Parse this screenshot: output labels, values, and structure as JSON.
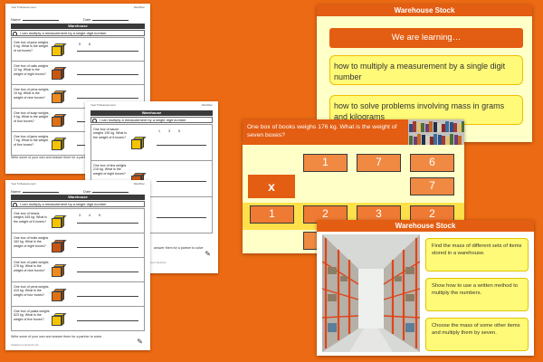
{
  "worksheets": [
    {
      "title": "Warehouse",
      "meta_left": "Year 5 Measurement",
      "meta_right": "Wed/Rec",
      "name_label": "Name",
      "date_label": "Date",
      "instruction": "I can multiply a measurement by a single digit number",
      "rows": [
        {
          "question": "One box of juice weighs 5 kg. What is the weight of six boxes?",
          "box_color": "#f5c400",
          "calc": "5  6"
        },
        {
          "question": "One box of nails weighs 12 kg. What is the weight of eight boxes?",
          "box_color": "#c95510",
          "calc": ""
        },
        {
          "question": "One box of pens weighs 15 kg. What is the weight of nine boxes?",
          "box_color": "#f08a1c",
          "calc": ""
        },
        {
          "question": "One box of soap weighs 9 kg. What is the weight of four boxes?",
          "box_color": "#e07012",
          "calc": ""
        },
        {
          "question": "One box of jams weighs 7 kg. What is the weight of five boxes?",
          "box_color": "#f5c400",
          "calc": ""
        }
      ],
      "footer": "Write some of your own and answer them for a partner to solve."
    },
    {
      "title": "Warehouse",
      "meta_left": "Year 5 Measurement",
      "meta_right": "Wed/Rec",
      "name_label": "Name",
      "date_label": "Date",
      "instruction": "I can multiply a measurement by a single digit number",
      "rows": [
        {
          "question": "One box of sauce weighs 135 kg. What is the weight of 6 boxes?",
          "box_color": "#f5c400",
          "calc": "1 3 5"
        },
        {
          "question": "One box of tins weighs 215 kg. What is the weight of eight boxes?",
          "box_color": "#c95510",
          "calc": ""
        },
        {
          "question": "One box of toys weighs 327 kg. What is the weight of nine boxes?",
          "box_color": "#f08a1c",
          "calc": ""
        }
      ],
      "footer": "answer them for a partner to solve",
      "logo": "Classroom Secrets"
    },
    {
      "title": "Warehouse",
      "meta_left": "Year 5 Measurement",
      "meta_right": "Wed/Rec",
      "name_label": "Name",
      "date_label": "Date",
      "instruction": "I can multiply a measurement by a single digit number",
      "rows": [
        {
          "question": "One box of beans weighs 345 kg. What is the weight of 6 boxes?",
          "box_color": "#f5c400",
          "calc": "3 4 5"
        },
        {
          "question": "One box of bolts weighs 162 kg. What is the weight of eight boxes?",
          "box_color": "#c95510",
          "calc": ""
        },
        {
          "question": "One box of paint weighs 278 kg. What is the weight of nine boxes?",
          "box_color": "#f08a1c",
          "calc": ""
        },
        {
          "question": "One box of pens weighs 415 kg. What is the weight of four boxes?",
          "box_color": "#e07012",
          "calc": ""
        },
        {
          "question": "One box of pasta weighs 523 kg. What is the weight of five boxes?",
          "box_color": "#f5c400",
          "calc": ""
        }
      ],
      "footer": "Write some of your own and answer them for a partner to solve.",
      "footer2": "Classroom Secrets Ltd"
    }
  ],
  "slide_learning": {
    "title": "Warehouse Stock",
    "banner": "We are learning…",
    "objectives": [
      "how to multiply a measurement by a single digit number",
      "how to solve problems involving mass in grams and kilograms"
    ]
  },
  "slide_grid": {
    "question": "One box of books weighs 176 kg. What is the weight of seven boxes?",
    "row1": [
      "1",
      "7",
      "6"
    ],
    "times_symbol": "x",
    "multiplier": "7",
    "row3": [
      "1",
      "2",
      "3",
      "2"
    ],
    "row4": [
      "",
      "",
      ""
    ]
  },
  "slide_stock": {
    "title": "Warehouse Stock",
    "points": [
      "Find the mass of different sets of items stored in a warehouse.",
      "Show how to use a written method to multiply the numbers.",
      "Choose the mass of some other items and multiply them by seven."
    ]
  },
  "colors": {
    "background": "#ec6a13",
    "accent": "#e35d12",
    "slide_cream": "#ffffc8",
    "highlight_yellow": "#fffa78"
  }
}
